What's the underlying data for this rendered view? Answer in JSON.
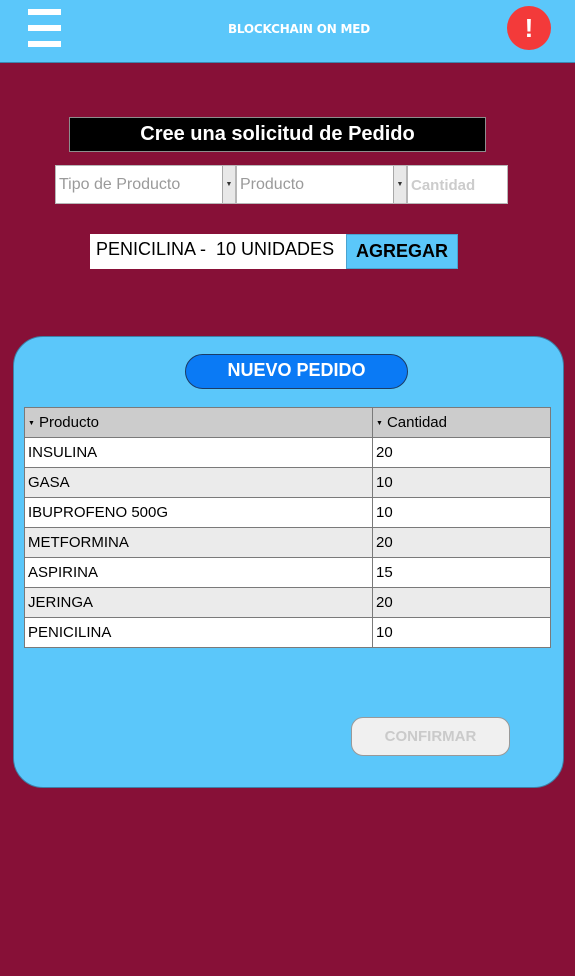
{
  "header": {
    "title": "BLOCKCHAIN ON MED",
    "alert_symbol": "!",
    "menu_icon": "hamburger-menu-icon",
    "bar_color": "#5bc7fa",
    "alert_color": "#f33a3a"
  },
  "form": {
    "title": "Cree una solicitud de Pedido",
    "product_type_placeholder": "Tipo de Producto",
    "product_placeholder": "Producto",
    "quantity_placeholder": "Cantidad",
    "summary": "PENICILINA -  10 UNIDADES",
    "add_label": "AGREGAR"
  },
  "order": {
    "title": "NUEVO PEDIDO",
    "columns": [
      "Producto",
      "Cantidad"
    ],
    "rows": [
      [
        "INSULINA",
        "20"
      ],
      [
        "GASA",
        "10"
      ],
      [
        "IBUPROFENO 500G",
        "10"
      ],
      [
        "METFORMINA",
        "20"
      ],
      [
        "ASPIRINA",
        "15"
      ],
      [
        "JERINGA",
        "20"
      ],
      [
        "PENICILINA",
        "10"
      ]
    ],
    "confirm_label": "CONFIRMAR"
  },
  "colors": {
    "background": "#871037",
    "panel": "#5bc7fa",
    "order_title_bg": "#0a7af5"
  }
}
